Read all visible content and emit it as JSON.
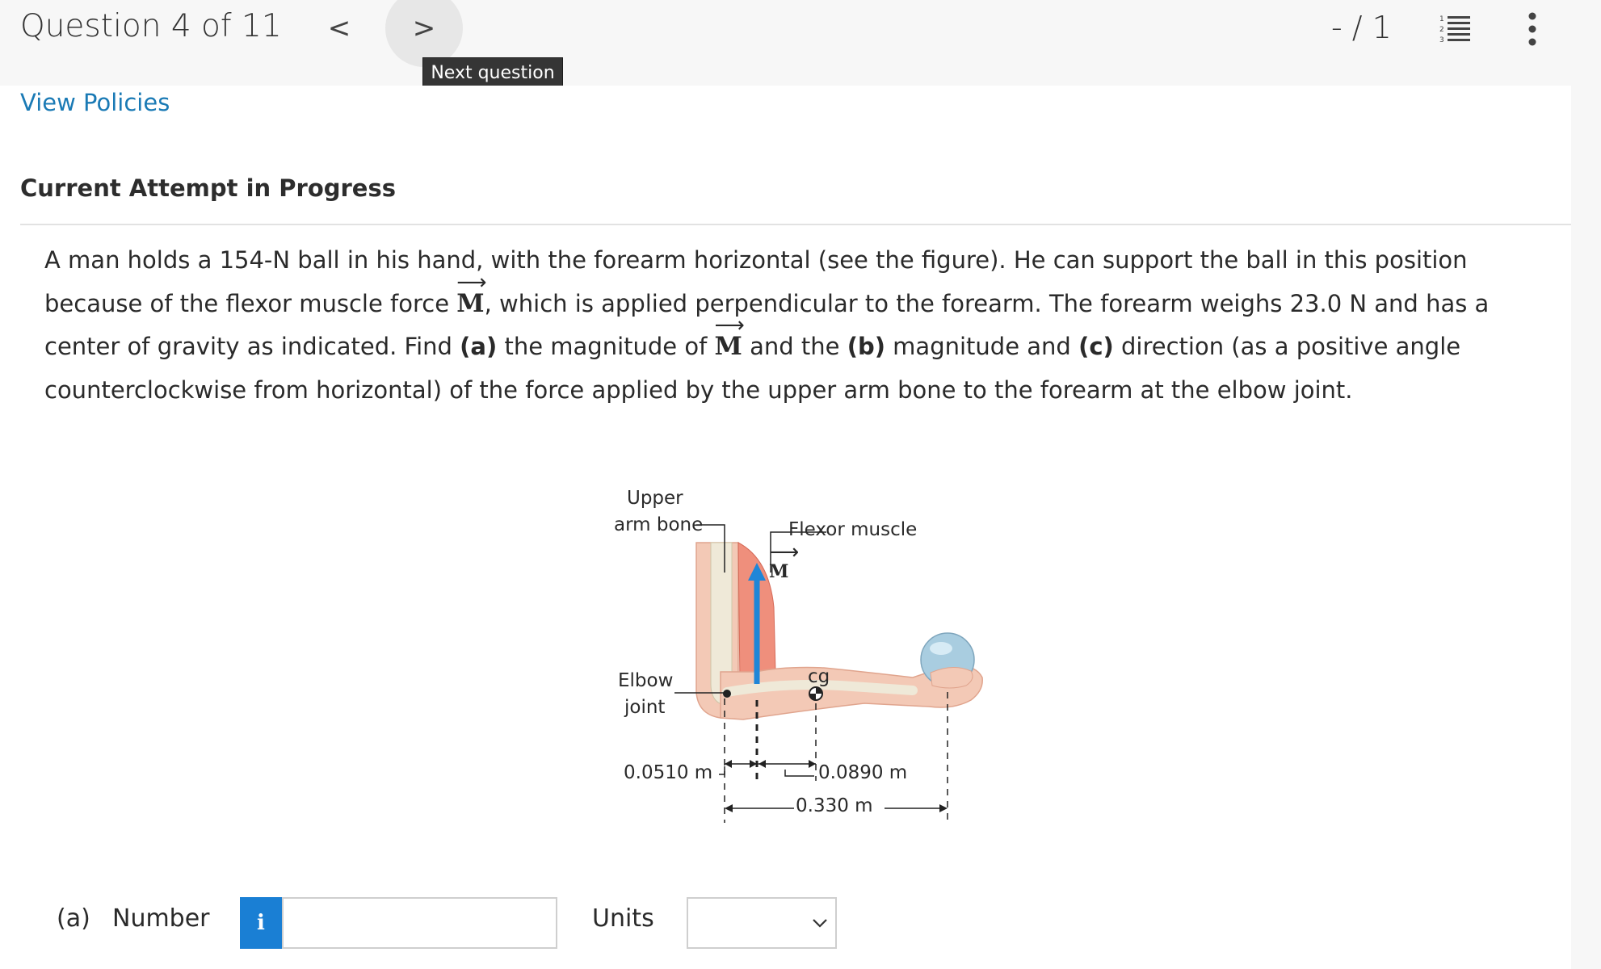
{
  "header": {
    "question_title": "Question 4 of 11",
    "prev_glyph": "<",
    "next_glyph": ">",
    "next_tooltip": "Next question",
    "score": "- / 1"
  },
  "links": {
    "view_policies": "View Policies"
  },
  "attempt_heading": "Current Attempt in Progress",
  "problem": {
    "p1": "A man holds a 154-N ball in his hand, with the forearm horizontal (see the figure). He can support the ball in this position because of the flexor muscle force ",
    "vec_symbol": "M",
    "p2": ", which is applied perpendicular to the forearm. The forearm weighs 23.0 N and has a center of gravity as indicated. Find ",
    "a": "(a)",
    "p3": " the magnitude of ",
    "p4": " and the ",
    "b": "(b)",
    "p5": " magnitude and ",
    "c": "(c)",
    "p6": " direction (as a positive angle counterclockwise from horizontal) of the force applied by the upper arm bone to the forearm at the elbow joint."
  },
  "figure": {
    "upper_arm_line1": "Upper",
    "upper_arm_line2": "arm bone",
    "flexor": "Flexor muscle",
    "m_label": "M",
    "cg": "cg",
    "elbow_line1": "Elbow",
    "elbow_line2": "joint",
    "d1": "0.0510 m",
    "d2": "0.0890 m",
    "d3": "0.330 m"
  },
  "answer": {
    "part": "(a)",
    "number_label": "Number",
    "info_glyph": "i",
    "number_value": "",
    "units_label": "Units",
    "units_value": ""
  },
  "colors": {
    "link": "#1a7ab5",
    "info_button": "#1a7fd4",
    "tooltip_bg": "#353535",
    "muscle_arrow": "#1f86d8"
  },
  "icons": [
    "chevron-left-icon",
    "chevron-right-icon",
    "numbered-list-icon",
    "more-vertical-icon",
    "info-icon",
    "chevron-down-icon"
  ]
}
